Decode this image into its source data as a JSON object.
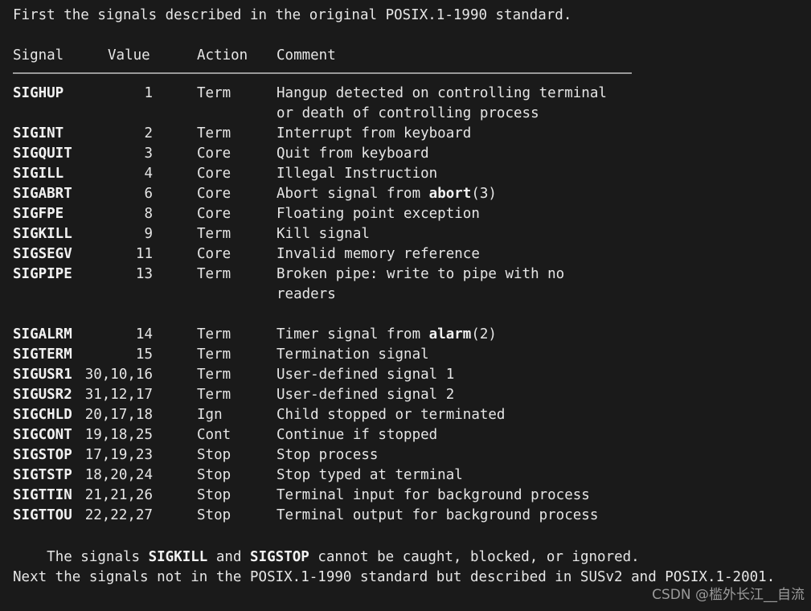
{
  "background_color": "#1a1a1a",
  "text_color": "#e6e6e6",
  "rule_color": "#9a9a9a",
  "intro": {
    "line": "First the signals described in the original POSIX.1-1990 standard."
  },
  "table": {
    "headers": {
      "signal": "Signal",
      "value": "Value",
      "action": "Action",
      "comment": "Comment"
    },
    "rows": [
      {
        "signal": "SIGHUP",
        "value": "1",
        "action": "Term",
        "comment_pre": "Hangup detected on controlling terminal",
        "comment_bold": "",
        "comment_post": "",
        "continuation": "or death of controlling process",
        "gap_after": false
      },
      {
        "signal": "SIGINT",
        "value": "2",
        "action": "Term",
        "comment_pre": "Interrupt from keyboard",
        "comment_bold": "",
        "comment_post": "",
        "continuation": "",
        "gap_after": false
      },
      {
        "signal": "SIGQUIT",
        "value": "3",
        "action": "Core",
        "comment_pre": "Quit from keyboard",
        "comment_bold": "",
        "comment_post": "",
        "continuation": "",
        "gap_after": false
      },
      {
        "signal": "SIGILL",
        "value": "4",
        "action": "Core",
        "comment_pre": "Illegal Instruction",
        "comment_bold": "",
        "comment_post": "",
        "continuation": "",
        "gap_after": false
      },
      {
        "signal": "SIGABRT",
        "value": "6",
        "action": "Core",
        "comment_pre": "Abort signal from ",
        "comment_bold": "abort",
        "comment_post": "(3)",
        "continuation": "",
        "gap_after": false
      },
      {
        "signal": "SIGFPE",
        "value": "8",
        "action": "Core",
        "comment_pre": "Floating point exception",
        "comment_bold": "",
        "comment_post": "",
        "continuation": "",
        "gap_after": false
      },
      {
        "signal": "SIGKILL",
        "value": "9",
        "action": "Term",
        "comment_pre": "Kill signal",
        "comment_bold": "",
        "comment_post": "",
        "continuation": "",
        "gap_after": false
      },
      {
        "signal": "SIGSEGV",
        "value": "11",
        "action": "Core",
        "comment_pre": "Invalid memory reference",
        "comment_bold": "",
        "comment_post": "",
        "continuation": "",
        "gap_after": false
      },
      {
        "signal": "SIGPIPE",
        "value": "13",
        "action": "Term",
        "comment_pre": "Broken pipe: write to pipe with no",
        "comment_bold": "",
        "comment_post": "",
        "continuation": "readers",
        "gap_after": true
      },
      {
        "signal": "SIGALRM",
        "value": "14",
        "action": "Term",
        "comment_pre": "Timer signal from ",
        "comment_bold": "alarm",
        "comment_post": "(2)",
        "continuation": "",
        "gap_after": false
      },
      {
        "signal": "SIGTERM",
        "value": "15",
        "action": "Term",
        "comment_pre": "Termination signal",
        "comment_bold": "",
        "comment_post": "",
        "continuation": "",
        "gap_after": false
      },
      {
        "signal": "SIGUSR1",
        "value": "30,10,16",
        "action": "Term",
        "comment_pre": "User-defined signal 1",
        "comment_bold": "",
        "comment_post": "",
        "continuation": "",
        "gap_after": false
      },
      {
        "signal": "SIGUSR2",
        "value": "31,12,17",
        "action": "Term",
        "comment_pre": "User-defined signal 2",
        "comment_bold": "",
        "comment_post": "",
        "continuation": "",
        "gap_after": false
      },
      {
        "signal": "SIGCHLD",
        "value": "20,17,18",
        "action": "Ign",
        "comment_pre": "Child stopped or terminated",
        "comment_bold": "",
        "comment_post": "",
        "continuation": "",
        "gap_after": false
      },
      {
        "signal": "SIGCONT",
        "value": "19,18,25",
        "action": "Cont",
        "comment_pre": "Continue if stopped",
        "comment_bold": "",
        "comment_post": "",
        "continuation": "",
        "gap_after": false
      },
      {
        "signal": "SIGSTOP",
        "value": "17,19,23",
        "action": "Stop",
        "comment_pre": "Stop process",
        "comment_bold": "",
        "comment_post": "",
        "continuation": "",
        "gap_after": false
      },
      {
        "signal": "SIGTSTP",
        "value": "18,20,24",
        "action": "Stop",
        "comment_pre": "Stop typed at terminal",
        "comment_bold": "",
        "comment_post": "",
        "continuation": "",
        "gap_after": false
      },
      {
        "signal": "SIGTTIN",
        "value": "21,21,26",
        "action": "Stop",
        "comment_pre": "Terminal input for background process",
        "comment_bold": "",
        "comment_post": "",
        "continuation": "",
        "gap_after": false
      },
      {
        "signal": "SIGTTOU",
        "value": "22,22,27",
        "action": "Stop",
        "comment_pre": "Terminal output for background process",
        "comment_bold": "",
        "comment_post": "",
        "continuation": "",
        "gap_after": false
      }
    ]
  },
  "paragraphs": {
    "caught": {
      "pre": "The signals ",
      "bold1": "SIGKILL",
      "mid": " and ",
      "bold2": "SIGSTOP",
      "post": " cannot be caught, blocked, or ignored."
    },
    "next": {
      "line": "Next the signals not in the POSIX.1-1990 standard but described in SUSv2 and POSIX.1-2001."
    }
  },
  "watermark": {
    "text": "CSDN @槛外长江__自流",
    "color": "#9b9b9b"
  }
}
